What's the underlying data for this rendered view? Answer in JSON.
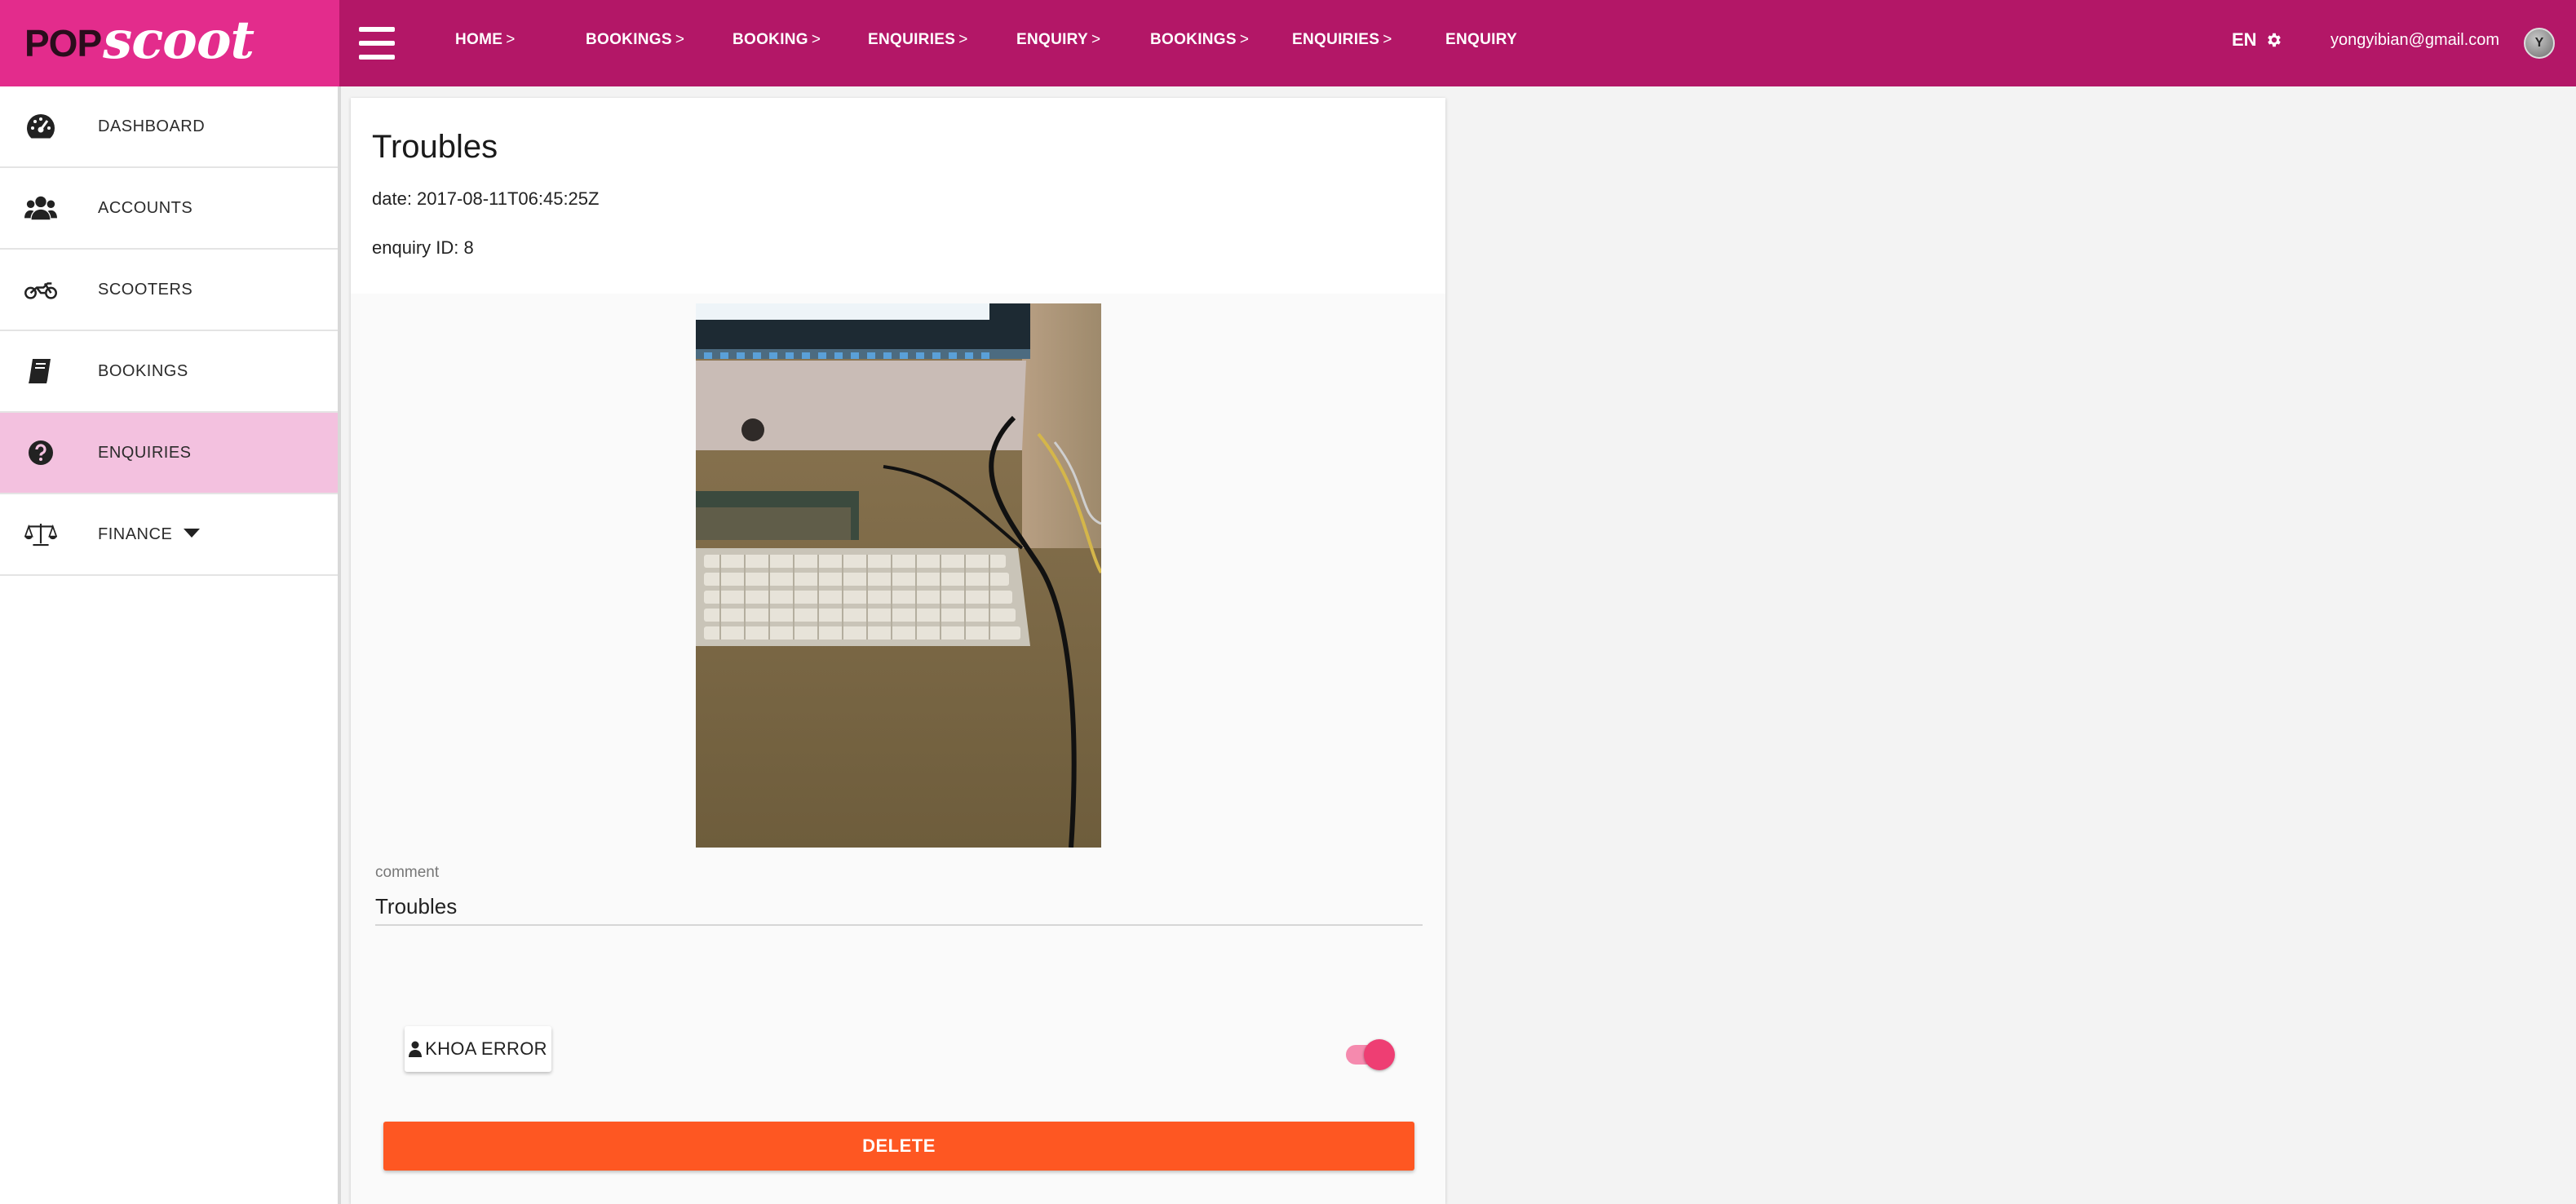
{
  "brand": {
    "logo_pop": "POP",
    "logo_scoot": "scoot",
    "color": "#e32c8c",
    "bar_color": "#b31767"
  },
  "topbar": {
    "breadcrumbs": [
      {
        "label": "HOME",
        "sep": ">"
      },
      {
        "label": "BOOKINGS",
        "sep": ">"
      },
      {
        "label": "BOOKING",
        "sep": ">"
      },
      {
        "label": "ENQUIRIES",
        "sep": ">"
      },
      {
        "label": "ENQUIRY",
        "sep": ">"
      },
      {
        "label": "BOOKINGS",
        "sep": ">"
      },
      {
        "label": "ENQUIRIES",
        "sep": ">"
      },
      {
        "label": "ENQUIRY",
        "sep": ""
      }
    ],
    "language": "EN",
    "language_icon": "gear-icon",
    "user_email": "yongyibian@gmail.com",
    "avatar_initial": "Y"
  },
  "sidebar": {
    "items": [
      {
        "label": "DASHBOARD",
        "icon": "speedometer-icon",
        "active": false
      },
      {
        "label": "ACCOUNTS",
        "icon": "users-icon",
        "active": false
      },
      {
        "label": "SCOOTERS",
        "icon": "motorcycle-icon",
        "active": false
      },
      {
        "label": "BOOKINGS",
        "icon": "book-icon",
        "active": false
      },
      {
        "label": "ENQUIRIES",
        "icon": "question-circle-icon",
        "active": true
      },
      {
        "label": "FINANCE",
        "icon": "balance-scale-icon",
        "active": false,
        "has_dropdown": true
      }
    ],
    "active_color": "#f3c1df"
  },
  "enquiry": {
    "title": "Troubles",
    "date_text": "date: 2017-08-11T06:45:25Z",
    "id_text": "enquiry ID: 8",
    "comment_label": "comment",
    "comment_value": "Troubles",
    "assignee_button": "KHOA ERROR",
    "assignee_icon": "user-icon",
    "resolved_toggle_on": true,
    "delete_label": "DELETE",
    "delete_color": "#fe5722",
    "toggle_color": "#ee3e73"
  }
}
